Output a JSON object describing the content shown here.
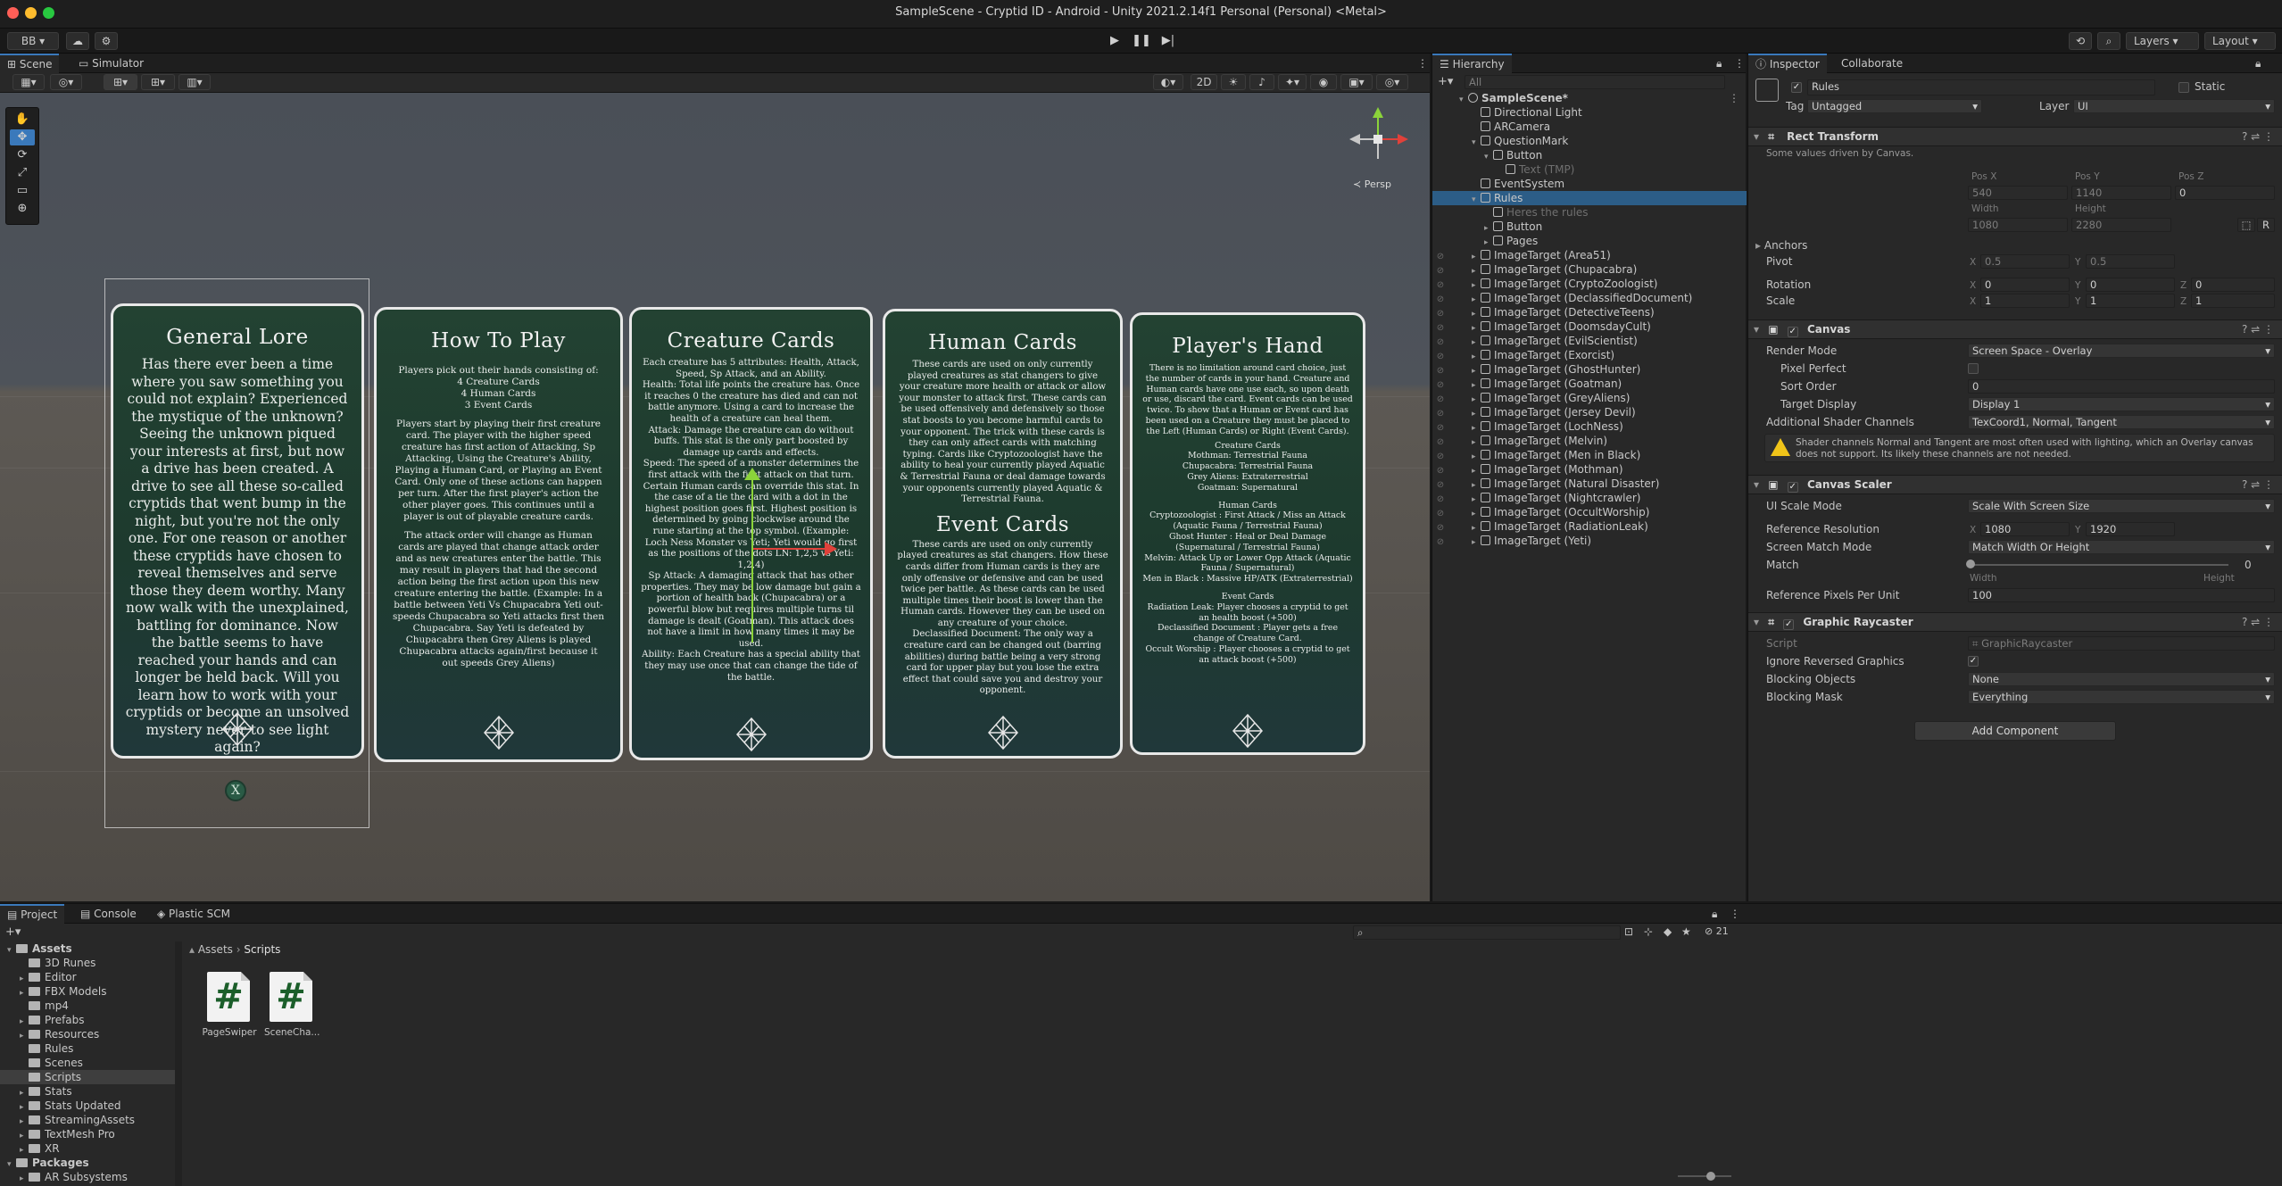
{
  "window": {
    "title": "SampleScene - Cryptid ID - Android - Unity 2021.2.14f1 Personal (Personal) <Metal>"
  },
  "toolbar": {
    "account": "BB ▾",
    "cloud_icon": "cloud-icon",
    "collab_icon": "settings-icon",
    "history_icon": "history-icon",
    "search_icon": "search-icon",
    "layers": "Layers",
    "layout": "Layout"
  },
  "scene": {
    "tabs": [
      "Scene",
      "Simulator"
    ],
    "toolbar_2d": "2D",
    "persp": "≺ Persp",
    "cards": [
      {
        "title": "General Lore",
        "body": "Has there ever been a time where you saw something you could not explain? Experienced the mystique of the unknown? Seeing the unknown piqued your interests at first, but now a drive has been created. A drive to see all these so-called cryptids that went bump in the night, but you're not the only one. For one reason or another these cryptids have chosen to reveal themselves and serve those they deem worthy. Many now walk with the unexplained, battling for dominance. Now the battle seems to have reached your hands and can longer be held back. Will you learn how to work with your cryptids or become an unsolved mystery never to see light again?",
        "close": "X"
      },
      {
        "title": "How To Play",
        "intro": "Players pick out their hands consisting of:",
        "list": [
          "4 Creature Cards",
          "4 Human Cards",
          "3 Event Cards"
        ],
        "p1": "Players start by playing their first creature card. The player with the higher speed creature has first action of Attacking, Sp Attacking, Using the Creature's Ability, Playing a Human Card, or Playing an Event Card. Only one of these actions can happen per turn. After the first player's action the other player goes. This continues until a player is out of playable creature cards.",
        "p2": "The attack order will change as Human cards are played that change attack order and as new creatures enter the battle. This may result in players that had the second action being the first action upon this new creature entering the battle. (Example: In a battle between Yeti Vs Chupacabra Yeti out-speeds Chupacabra so Yeti attacks first then Chupacabra. Say Yeti is defeated by Chupacabra then Grey Aliens is played Chupacabra attacks again/first because it out speeds Grey Aliens)"
      },
      {
        "title": "Creature Cards",
        "p1": "Each creature has 5 attributes: Health, Attack, Speed, Sp Attack, and an Ability.",
        "p2": "Health: Total life points the creature has. Once it reaches 0 the creature has died and can not battle anymore. Using a card to increase the health of a creature can heal them.",
        "p3": "Attack: Damage the creature can do without buffs. This stat is the only part boosted by damage up cards and effects.",
        "p4": "Speed: The speed of a monster determines the first attack with the first attack on that turn. Certain Human cards can override this stat. In the case of a tie the card with a dot in the highest position goes first. Highest position is determined by going clockwise around the rune starting at the top symbol. (Example: Loch Ness Monster vs Yeti; Yeti would go first as the positions of the dots LN: 1,2,5 vs Yeti: 1,2,4)",
        "p5": "Sp Attack: A damaging attack that has other properties. They may be low damage but gain a portion of health back (Chupacabra) or a powerful blow but requires multiple turns til damage is dealt (Goatman). This attack does not have a limit in how many times it may be used.",
        "p6": "Ability: Each Creature has a special ability that they may use once that can change the tide of the battle."
      },
      {
        "title": "Human Cards",
        "p1": "These cards are used on only currently played creatures as stat changers to give your creature more health or attack or allow your monster to attack first. These cards can be used offensively and defensively so those stat boosts to you become harmful cards to your opponent. The trick with these cards is they can only affect cards with matching typing. Cards like Cryptozoologist have the ability to heal your currently played Aquatic & Terrestrial Fauna or deal damage towards your opponents currently played Aquatic & Terrestrial Fauna.",
        "title2": "Event Cards",
        "p2": "These cards are used on only currently played creatures as stat changers. How these cards differ from Human cards is they are only offensive or defensive and can be used twice per battle. As these cards can be used multiple times their boost is lower than the Human cards. However they can be used on any creature of your choice.",
        "p3": "Declassified Document: The only way a creature card can be changed out (barring abilities) during battle being a very strong card for upper play but you lose the extra effect that could save you and destroy your opponent."
      },
      {
        "title": "Player's Hand",
        "p1": "There is no limitation around card choice, just the number of cards in your hand. Creature and Human cards have one use each, so upon death or use, discard the card. Event cards can be used twice. To show that a Human or Event card has been used on a Creature they must be placed to the Left (Human Cards) or Right (Event Cards).",
        "h1": "Creature Cards",
        "l1": [
          "Mothman: Terrestrial Fauna",
          "Chupacabra: Terrestrial Fauna",
          "Grey Aliens: Extraterrestrial",
          "Goatman: Supernatural"
        ],
        "h2": "Human Cards",
        "l2": [
          "Cryptozoologist : First Attack / Miss an Attack (Aquatic Fauna / Terrestrial Fauna)",
          "Ghost Hunter : Heal or Deal Damage (Supernatural / Terrestrial Fauna)",
          "Melvin: Attack Up or Lower Opp Attack (Aquatic Fauna / Supernatural)",
          "Men in Black : Massive HP/ATK (Extraterrestrial)"
        ],
        "h3": "Event Cards",
        "l3": [
          "Radiation Leak: Player chooses a cryptid to get an health boost (+500)",
          "Declassified Document : Player gets a free change of Creature Card.",
          "Occult Worship : Player chooses a cryptid to get an attack boost (+500)"
        ]
      }
    ]
  },
  "hierarchy": {
    "tab": "Hierarchy",
    "search_placeholder": "All",
    "rows": [
      {
        "label": "SampleScene*",
        "depth": 0,
        "kind": "scene",
        "arrow": "▾"
      },
      {
        "label": "Directional Light",
        "depth": 1,
        "kind": "obj",
        "arrow": ""
      },
      {
        "label": "ARCamera",
        "depth": 1,
        "kind": "obj",
        "arrow": ""
      },
      {
        "label": "QuestionMark",
        "depth": 1,
        "kind": "obj",
        "arrow": "▾"
      },
      {
        "label": "Button",
        "depth": 2,
        "kind": "obj",
        "arrow": "▾"
      },
      {
        "label": "Text (TMP)",
        "depth": 3,
        "kind": "dim",
        "arrow": ""
      },
      {
        "label": "EventSystem",
        "depth": 1,
        "kind": "obj",
        "arrow": ""
      },
      {
        "label": "Rules",
        "depth": 1,
        "kind": "sel",
        "arrow": "▾"
      },
      {
        "label": "Heres the rules",
        "depth": 2,
        "kind": "dim",
        "arrow": ""
      },
      {
        "label": "Button",
        "depth": 2,
        "kind": "obj",
        "arrow": "▸"
      },
      {
        "label": "Pages",
        "depth": 2,
        "kind": "obj",
        "arrow": "▸"
      },
      {
        "label": "ImageTarget (Area51)",
        "depth": 1,
        "kind": "obj",
        "arrow": "▸"
      },
      {
        "label": "ImageTarget (Chupacabra)",
        "depth": 1,
        "kind": "obj",
        "arrow": "▸"
      },
      {
        "label": "ImageTarget (CryptoZoologist)",
        "depth": 1,
        "kind": "obj",
        "arrow": "▸"
      },
      {
        "label": "ImageTarget (DeclassifiedDocument)",
        "depth": 1,
        "kind": "obj",
        "arrow": "▸"
      },
      {
        "label": "ImageTarget (DetectiveTeens)",
        "depth": 1,
        "kind": "obj",
        "arrow": "▸"
      },
      {
        "label": "ImageTarget (DoomsdayCult)",
        "depth": 1,
        "kind": "obj",
        "arrow": "▸"
      },
      {
        "label": "ImageTarget (EvilScientist)",
        "depth": 1,
        "kind": "obj",
        "arrow": "▸"
      },
      {
        "label": "ImageTarget (Exorcist)",
        "depth": 1,
        "kind": "obj",
        "arrow": "▸"
      },
      {
        "label": "ImageTarget (GhostHunter)",
        "depth": 1,
        "kind": "obj",
        "arrow": "▸"
      },
      {
        "label": "ImageTarget (Goatman)",
        "depth": 1,
        "kind": "obj",
        "arrow": "▸"
      },
      {
        "label": "ImageTarget (GreyAliens)",
        "depth": 1,
        "kind": "obj",
        "arrow": "▸"
      },
      {
        "label": "ImageTarget (Jersey Devil)",
        "depth": 1,
        "kind": "obj",
        "arrow": "▸"
      },
      {
        "label": "ImageTarget (LochNess)",
        "depth": 1,
        "kind": "obj",
        "arrow": "▸"
      },
      {
        "label": "ImageTarget (Melvin)",
        "depth": 1,
        "kind": "obj",
        "arrow": "▸"
      },
      {
        "label": "ImageTarget (Men in Black)",
        "depth": 1,
        "kind": "obj",
        "arrow": "▸"
      },
      {
        "label": "ImageTarget (Mothman)",
        "depth": 1,
        "kind": "obj",
        "arrow": "▸"
      },
      {
        "label": "ImageTarget (Natural Disaster)",
        "depth": 1,
        "kind": "obj",
        "arrow": "▸"
      },
      {
        "label": "ImageTarget (Nightcrawler)",
        "depth": 1,
        "kind": "obj",
        "arrow": "▸"
      },
      {
        "label": "ImageTarget (OccultWorship)",
        "depth": 1,
        "kind": "obj",
        "arrow": "▸"
      },
      {
        "label": "ImageTarget (RadiationLeak)",
        "depth": 1,
        "kind": "obj",
        "arrow": "▸"
      },
      {
        "label": "ImageTarget (Yeti)",
        "depth": 1,
        "kind": "obj",
        "arrow": "▸"
      }
    ]
  },
  "inspector": {
    "tabs": [
      "Inspector",
      "Collaborate"
    ],
    "object_name": "Rules",
    "static_label": "Static",
    "tag_label": "Tag",
    "tag_value": "Untagged",
    "layer_label": "Layer",
    "layer_value": "UI",
    "rect_transform": {
      "title": "Rect Transform",
      "note": "Some values driven by Canvas.",
      "pos_x_label": "Pos X",
      "pos_y_label": "Pos Y",
      "pos_z_label": "Pos Z",
      "pos_x": "540",
      "pos_y": "1140",
      "pos_z": "0",
      "width_label": "Width",
      "height_label": "Height",
      "width": "1080",
      "height": "2280",
      "r_btn": "R",
      "anchors": "Anchors",
      "pivot": "Pivot",
      "pivot_x": "0.5",
      "pivot_y": "0.5",
      "rotation": "Rotation",
      "rot_x": "0",
      "rot_y": "0",
      "rot_z": "0",
      "scale": "Scale",
      "scale_x": "1",
      "scale_y": "1",
      "scale_z": "1"
    },
    "canvas": {
      "title": "Canvas",
      "render_mode_label": "Render Mode",
      "render_mode": "Screen Space - Overlay",
      "pixel_perfect_label": "Pixel Perfect",
      "sort_order_label": "Sort Order",
      "sort_order": "0",
      "target_display_label": "Target Display",
      "target_display": "Display 1",
      "shader_label": "Additional Shader Channels",
      "shader_value": "TexCoord1, Normal, Tangent",
      "warning": "Shader channels Normal and Tangent are most often used with lighting, which an Overlay canvas does not support. Its likely these channels are not needed."
    },
    "canvas_scaler": {
      "title": "Canvas Scaler",
      "ui_scale_label": "UI Scale Mode",
      "ui_scale": "Scale With Screen Size",
      "ref_res_label": "Reference Resolution",
      "ref_x": "1080",
      "ref_y": "1920",
      "match_mode_label": "Screen Match Mode",
      "match_mode": "Match Width Or Height",
      "match_label": "Match",
      "match_value": "0",
      "match_width": "Width",
      "match_height": "Height",
      "ref_ppu_label": "Reference Pixels Per Unit",
      "ref_ppu": "100"
    },
    "graphic_raycaster": {
      "title": "Graphic Raycaster",
      "script_label": "Script",
      "script_value": "GraphicRaycaster",
      "ignore_label": "Ignore Reversed Graphics",
      "blocking_objects_label": "Blocking Objects",
      "blocking_objects": "None",
      "blocking_mask_label": "Blocking Mask",
      "blocking_mask": "Everything"
    },
    "add_component": "Add Component"
  },
  "project": {
    "tabs": [
      "Project",
      "Console",
      "Plastic SCM"
    ],
    "breadcrumb": [
      "Assets",
      "Scripts"
    ],
    "hidden_count": "21",
    "tree": [
      {
        "label": "Assets",
        "depth": 0,
        "arrow": "▾",
        "bold": true
      },
      {
        "label": "3D Runes",
        "depth": 1,
        "arrow": ""
      },
      {
        "label": "Editor",
        "depth": 1,
        "arrow": "▸"
      },
      {
        "label": "FBX Models",
        "depth": 1,
        "arrow": "▸"
      },
      {
        "label": "mp4",
        "depth": 1,
        "arrow": ""
      },
      {
        "label": "Prefabs",
        "depth": 1,
        "arrow": "▸"
      },
      {
        "label": "Resources",
        "depth": 1,
        "arrow": "▸"
      },
      {
        "label": "Rules",
        "depth": 1,
        "arrow": ""
      },
      {
        "label": "Scenes",
        "depth": 1,
        "arrow": ""
      },
      {
        "label": "Scripts",
        "depth": 1,
        "arrow": "",
        "selected": true
      },
      {
        "label": "Stats",
        "depth": 1,
        "arrow": "▸"
      },
      {
        "label": "Stats Updated",
        "depth": 1,
        "arrow": "▸"
      },
      {
        "label": "StreamingAssets",
        "depth": 1,
        "arrow": "▸"
      },
      {
        "label": "TextMesh Pro",
        "depth": 1,
        "arrow": "▸"
      },
      {
        "label": "XR",
        "depth": 1,
        "arrow": "▸"
      },
      {
        "label": "Packages",
        "depth": 0,
        "arrow": "▾",
        "bold": true
      },
      {
        "label": "AR Subsystems",
        "depth": 1,
        "arrow": "▸"
      }
    ],
    "files": [
      {
        "label": "PageSwiper",
        "icon": "#"
      },
      {
        "label": "SceneCha...",
        "icon": "#"
      }
    ]
  }
}
